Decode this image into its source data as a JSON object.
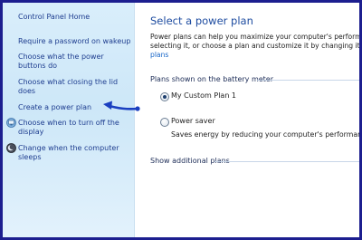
{
  "sidebar": {
    "home_link": "Control Panel Home",
    "links": [
      {
        "lines": [
          "Require a password on wakeup"
        ]
      },
      {
        "lines": [
          "Choose what the power",
          "buttons do"
        ]
      },
      {
        "lines": [
          "Choose what closing the lid",
          "does"
        ]
      },
      {
        "lines": [
          "Create a power plan"
        ]
      },
      {
        "lines": [
          "Choose when to turn off the",
          "display"
        ],
        "icon": "display-icon"
      },
      {
        "lines": [
          "Change when the computer",
          "sleeps"
        ],
        "icon": "sleep-moon-icon"
      }
    ]
  },
  "main": {
    "title": "Select a power plan",
    "description": {
      "line1": "Power plans can help you maximize your computer's performa",
      "line2": "selecting it, or choose a plan and customize it by changing its",
      "line3_link": "plans"
    },
    "section_label": "Plans shown on the battery meter",
    "plans": [
      {
        "label": "My Custom Plan 1",
        "selected": true,
        "description": ""
      },
      {
        "label": "Power saver",
        "selected": false,
        "description": "Saves energy by reducing your computer's performance"
      }
    ],
    "show_additional": "Show additional plans"
  },
  "annotation": {
    "icon": "blue-pointer-arrow-icon",
    "color": "#1a3fc0"
  },
  "colors": {
    "frame_border": "#1c1e8f",
    "link": "#1e3d8f",
    "title": "#1e4ca0"
  }
}
